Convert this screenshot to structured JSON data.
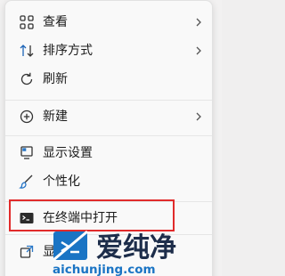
{
  "menu": {
    "items": [
      {
        "id": "view",
        "label": "查看",
        "icon": "grid-icon",
        "has_submenu": true
      },
      {
        "id": "sort",
        "label": "排序方式",
        "icon": "sort-arrows-icon",
        "has_submenu": true
      },
      {
        "id": "refresh",
        "label": "刷新",
        "icon": "refresh-icon",
        "has_submenu": false
      },
      {
        "id": "new",
        "label": "新建",
        "icon": "plus-circle-icon",
        "has_submenu": true
      },
      {
        "id": "display",
        "label": "显示设置",
        "icon": "display-icon",
        "has_submenu": false
      },
      {
        "id": "personalize",
        "label": "个性化",
        "icon": "brush-icon",
        "has_submenu": false
      },
      {
        "id": "terminal",
        "label": "在终端中打开",
        "icon": "terminal-icon",
        "has_submenu": false
      },
      {
        "id": "more",
        "label": "显",
        "icon": "external-icon",
        "has_submenu": false
      }
    ]
  },
  "watermark": {
    "brand_text": "爱纯净",
    "url_text": "aichunjing.com"
  },
  "colors": {
    "menu_bg": "#f9f9f9",
    "text": "#1b1b1b",
    "highlight_border": "#e12b2b",
    "watermark_blue": "#1a74c4",
    "watermark_dark": "#1d2d4a"
  }
}
